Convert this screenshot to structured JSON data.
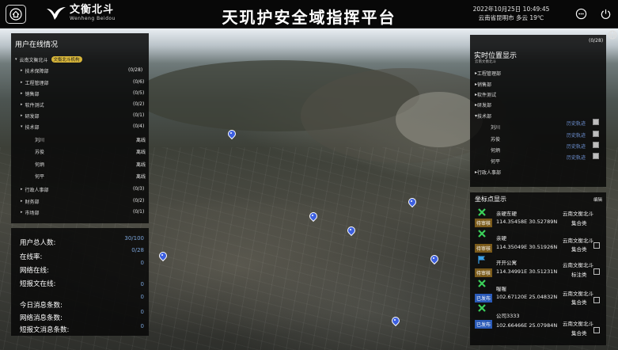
{
  "header": {
    "logo_cn": "文衡北斗",
    "logo_en": "Wenheng  Beidou",
    "title": "天玑护安全域指挥平台",
    "date": "2022年10月25日 10:49:45",
    "weather": "云南省昆明市  多云 19℃"
  },
  "online_panel": {
    "title": "用户在线情况",
    "root": "云南文衡北斗",
    "root_badge": "文衡北斗机构",
    "depts": [
      {
        "label": "技术保障部",
        "count": "(0/28)"
      },
      {
        "label": "工程管理部",
        "count": "(0/6)"
      },
      {
        "label": "销售部",
        "count": "(0/5)"
      },
      {
        "label": "软件测试",
        "count": "(0/2)"
      },
      {
        "label": "研发部",
        "count": "(0/1)"
      },
      {
        "label": "技术部",
        "count": "(0/4)"
      }
    ],
    "members": [
      {
        "name": "刘川",
        "status": "离线"
      },
      {
        "name": "苏俊",
        "status": "离线"
      },
      {
        "name": "何炳",
        "status": "离线"
      },
      {
        "name": "何平",
        "status": "离线"
      }
    ],
    "depts2": [
      {
        "label": "行政人事部",
        "count": "(0/3)"
      },
      {
        "label": "财务部",
        "count": "(0/2)"
      },
      {
        "label": "市场部",
        "count": "(0/1)"
      }
    ]
  },
  "stats": {
    "total_label": "用户总人数:",
    "total_value": "30/100",
    "online_rate_label": "在线率:",
    "online_rate_value": "0/28",
    "network_online_label": "网络在线:",
    "network_online_value": "0",
    "sms_online_label": "短报文在线:",
    "sms_online_value": "0",
    "today_msg_label": "今日消息条数:",
    "today_msg_value": "0",
    "network_msg_label": "网络消息条数:",
    "network_msg_value": "0",
    "sms_msg_label": "短报文消息条数:",
    "sms_msg_value": "0"
  },
  "location_panel": {
    "title": "实时位置显示",
    "count": "(0/28)",
    "top_item": "云南文衡北斗",
    "depts": [
      "工程管理部",
      "销售部",
      "软件测试",
      "研发部",
      "技术部"
    ],
    "members": [
      {
        "name": "刘川",
        "action": "历史轨迹"
      },
      {
        "name": "苏俊",
        "action": "历史轨迹"
      },
      {
        "name": "何炳",
        "action": "历史轨迹"
      },
      {
        "name": "何平",
        "action": "历史轨迹"
      }
    ],
    "bottom_item": "行政人事部"
  },
  "coord_panel": {
    "title": "坐标点显示",
    "edit": "编辑",
    "points": [
      {
        "name": "亲硬东硬",
        "coord": "114.35458E  30.52789N",
        "org": "云南文衡北斗",
        "tag": "待审核",
        "group": "集合类"
      },
      {
        "name": "亲硬",
        "coord": "114.35049E  30.51926N",
        "org": "云南文衡北斗",
        "tag": "待审核",
        "group": "集合类"
      },
      {
        "name": "开开公寓",
        "coord": "114.34991E  30.51231N",
        "org": "云南文衡北斗",
        "tag": "待审核",
        "group": "标注类"
      },
      {
        "name": "喔喔",
        "coord": "102.67120E  25.04832N",
        "org": "云南文衡北斗",
        "tag": "已发布",
        "group": "集合类"
      },
      {
        "name": "公司3333",
        "coord": "102.66466E  25.07984N",
        "org": "云南文衡北斗",
        "tag": "已发布",
        "group": "集合类"
      }
    ]
  },
  "colors": {
    "accent_blue": "#3f6fd6",
    "tag_pending": "#7a5a1a",
    "tag_published": "#2a5ab8",
    "badge_gold": "#d8b63a"
  }
}
